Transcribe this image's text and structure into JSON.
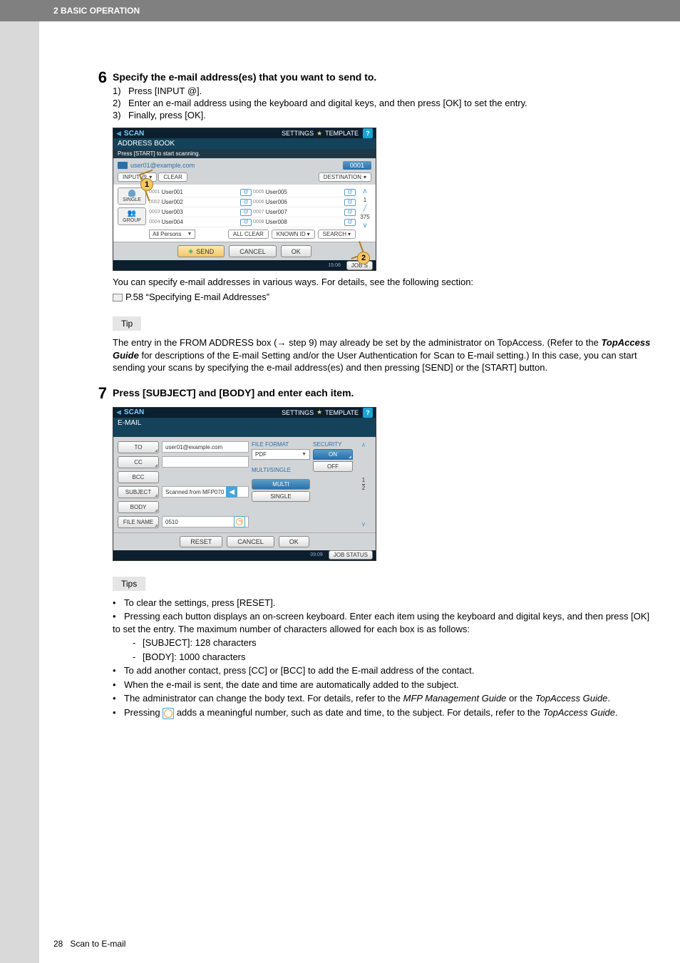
{
  "header": {
    "section": "2 BASIC OPERATION"
  },
  "footer": {
    "page_num": "28",
    "section_name": "Scan to E-mail"
  },
  "step6": {
    "num": "6",
    "title": "Specify the e-mail address(es) that you want to send to.",
    "sub1_num": "1)",
    "sub1": "Press [INPUT @].",
    "sub2_num": "2)",
    "sub2": "Enter an e-mail address using the keyboard and digital keys, and then press [OK] to set the entry.",
    "sub3_num": "3)",
    "sub3": "Finally, press [OK].",
    "after_shot": "You can specify e-mail addresses in various ways. For details, see the following section:",
    "ref": "P.58 “Specifying E-mail Addresses”",
    "tip_label": "Tip",
    "tip_text_pre": "The entry in the FROM ADDRESS box (",
    "tip_arrow": "→",
    "tip_text_mid": " step 9) may already be set by the administrator on TopAccess. (Refer to the ",
    "tip_em": "TopAccess Guide",
    "tip_text_post": " for descriptions of the E-mail Setting and/or the User Authentication for Scan to E-mail setting.) In this case, you can start sending your scans by specifying the e-mail address(es) and then pressing [SEND] or the [START] button."
  },
  "shot1": {
    "top_title": "SCAN",
    "top_settings": "SETTINGS",
    "top_template": "TEMPLATE",
    "help": "?",
    "subtitle": "ADDRESS BOOK",
    "note": "Press [START] to start scanning.",
    "addr": "user01@example.com",
    "count": "0001",
    "input_btn": "INPUT @",
    "clear_btn": "CLEAR",
    "dest_btn": "DESTINATION",
    "single": "SINGLE",
    "group": "GROUP",
    "rows": [
      {
        "l_id": "0001",
        "l_name": "User001",
        "r_id": "0005",
        "r_name": "User005"
      },
      {
        "l_id": "0002",
        "l_name": "User002",
        "r_id": "0006",
        "r_name": "User006"
      },
      {
        "l_id": "0003",
        "l_name": "User003",
        "r_id": "0007",
        "r_name": "User007"
      },
      {
        "l_id": "0004",
        "l_name": "User004",
        "r_id": "0008",
        "r_name": "User008"
      }
    ],
    "side_count": "375",
    "side_page": "1",
    "dropdown": "All Persons",
    "allclear": "ALL CLEAR",
    "knownid": "KNOWN ID",
    "search": "SEARCH",
    "send": "SEND",
    "cancel": "CANCEL",
    "ok": "OK",
    "timestamp": "15:06",
    "jobstatus": "JOB S",
    "callout1": "1",
    "callout2": "2"
  },
  "step7": {
    "num": "7",
    "title": "Press [SUBJECT] and [BODY] and enter each item."
  },
  "shot2": {
    "top_title": "SCAN",
    "top_settings": "SETTINGS",
    "top_template": "TEMPLATE",
    "help": "?",
    "subtitle": "E-MAIL",
    "to": "TO",
    "cc": "CC",
    "bcc": "BCC",
    "subject": "SUBJECT",
    "body": "BODY",
    "filename": "FILE NAME",
    "to_val": "user01@example.com",
    "subject_val": "Scanned from MFP070",
    "filename_val": "0510",
    "fileformat_label": "FILE FORMAT",
    "fileformat_val": "PDF",
    "multisingle_label": "MULTI/SINGLE",
    "multi": "MULTI",
    "single": "SINGLE",
    "security_label": "SECURITY",
    "on": "ON",
    "off": "OFF",
    "page_cur": "1",
    "page_tot": "2",
    "reset": "RESET",
    "cancel": "CANCEL",
    "ok": "OK",
    "timestamp": "09:09",
    "jobstatus": "JOB STATUS"
  },
  "tips": {
    "label": "Tips",
    "b1": "To clear the settings, press [RESET].",
    "b2": "Pressing each button displays an on-screen keyboard. Enter each item using the keyboard and digital keys, and then press [OK] to set the entry. The maximum number of characters allowed for each box is as follows:",
    "d1": "[SUBJECT]: 128 characters",
    "d2": "[BODY]: 1000 characters",
    "b3": "To add another contact, press [CC] or [BCC] to add the E-mail address of the contact.",
    "b4": "When the e-mail is sent, the date and time are automatically added to the subject.",
    "b5_pre": "The administrator can change the body text. For details, refer to the ",
    "b5_em1": "MFP Management Guide",
    "b5_mid": " or the ",
    "b5_em2": "TopAccess Guide",
    "b5_post": ".",
    "b6_pre": "Pressing ",
    "b6_mid": " adds a meaningful number, such as date and time, to the subject. For details, refer to the ",
    "b6_em": "TopAccess Guide",
    "b6_post": "."
  }
}
